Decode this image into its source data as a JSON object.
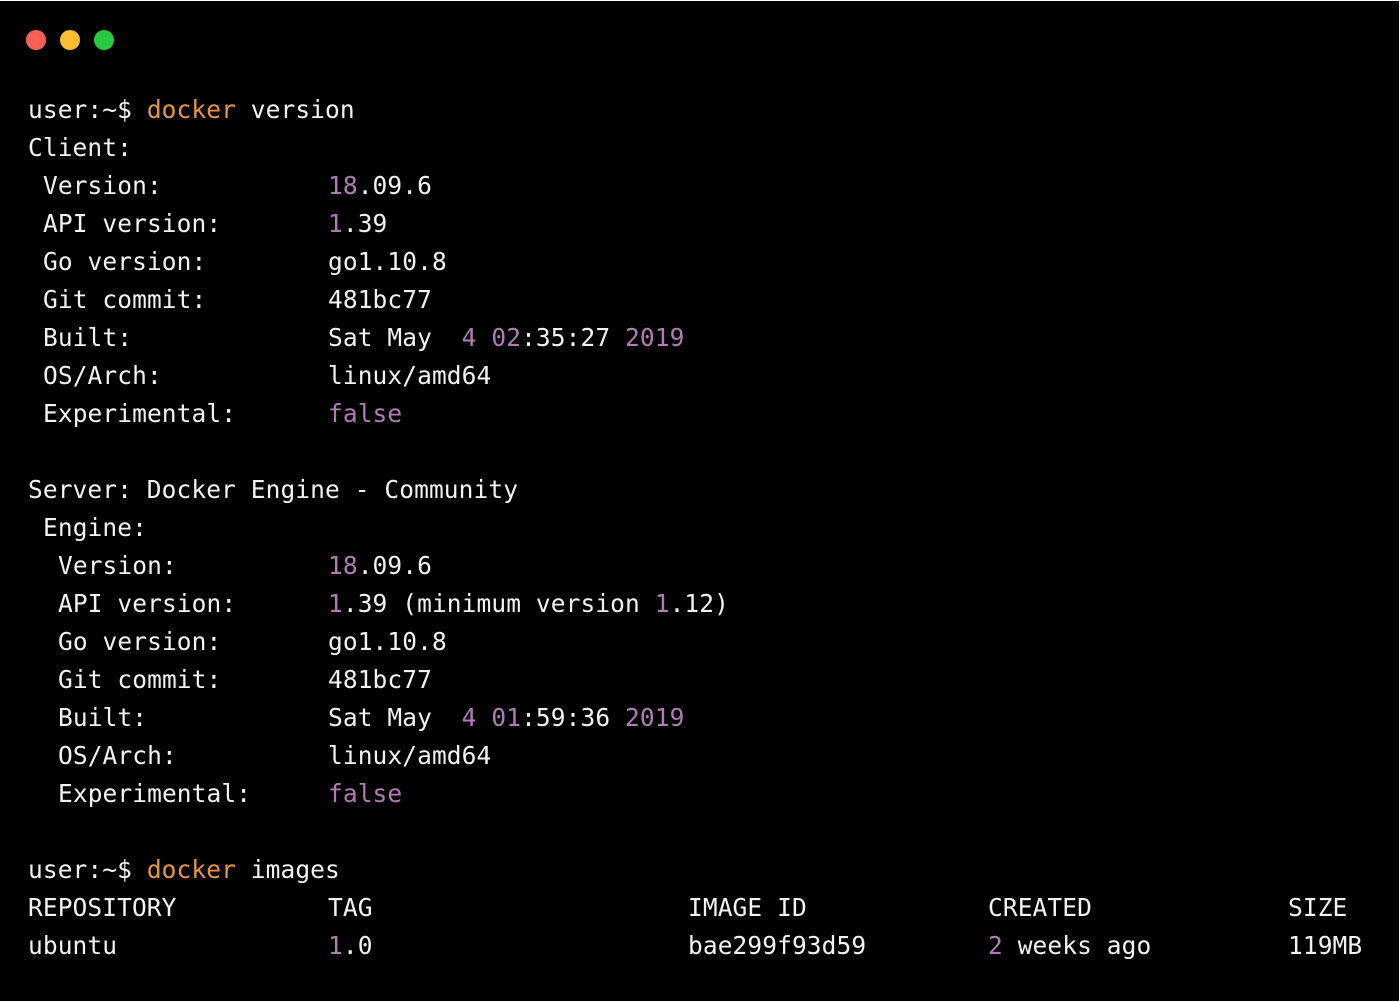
{
  "colors": {
    "background": "#000000",
    "text": "#f2f2f2",
    "command": "#e8953f",
    "number": "#b27bb6",
    "close_dot": "#fe5f57",
    "minimize_dot": "#febc2e",
    "maximize_dot": "#28c840"
  },
  "prompt": "user:~$",
  "cmd_version": {
    "program": "docker",
    "args": "version"
  },
  "client": {
    "header": "Client:",
    "version": {
      "label": "Version:",
      "num": "18",
      "rest": ".09.6"
    },
    "api_version": {
      "label": "API version:",
      "num": "1",
      "rest": ".39"
    },
    "go_version": {
      "label": "Go version:",
      "value": "go1.10.8"
    },
    "git_commit": {
      "label": "Git commit:",
      "value": "481bc77"
    },
    "built": {
      "label": "Built:",
      "day": "Sat May",
      "date": "4",
      "hour": "02",
      "time_rest": ":35:27",
      "year": "2019"
    },
    "os_arch": {
      "label": "OS/Arch:",
      "value": "linux/amd64"
    },
    "experimental": {
      "label": "Experimental:",
      "value": "false"
    }
  },
  "server": {
    "header": "Server: Docker Engine - Community",
    "engine_header": "Engine:",
    "version": {
      "label": "Version:",
      "num": "18",
      "rest": ".09.6"
    },
    "api_version": {
      "label": "API version:",
      "num": "1",
      "rest": ".39 (minimum version ",
      "min_num": "1",
      "min_rest": ".12)"
    },
    "go_version": {
      "label": "Go version:",
      "value": "go1.10.8"
    },
    "git_commit": {
      "label": "Git commit:",
      "value": "481bc77"
    },
    "built": {
      "label": "Built:",
      "day": "Sat May",
      "date": "4",
      "hour": "01",
      "time_rest": ":59:36",
      "year": "2019"
    },
    "os_arch": {
      "label": "OS/Arch:",
      "value": "linux/amd64"
    },
    "experimental": {
      "label": "Experimental:",
      "value": "false"
    }
  },
  "cmd_images": {
    "program": "docker",
    "args": "images"
  },
  "images_table": {
    "headers": [
      "REPOSITORY",
      "TAG",
      "IMAGE ID",
      "CREATED",
      "SIZE"
    ],
    "rows": [
      {
        "repository": "ubuntu",
        "tag_num": "1",
        "tag_rest": ".0",
        "image_id": "bae299f93d59",
        "created_num": "2",
        "created_rest": " weeks ago",
        "size": "119MB"
      }
    ]
  }
}
